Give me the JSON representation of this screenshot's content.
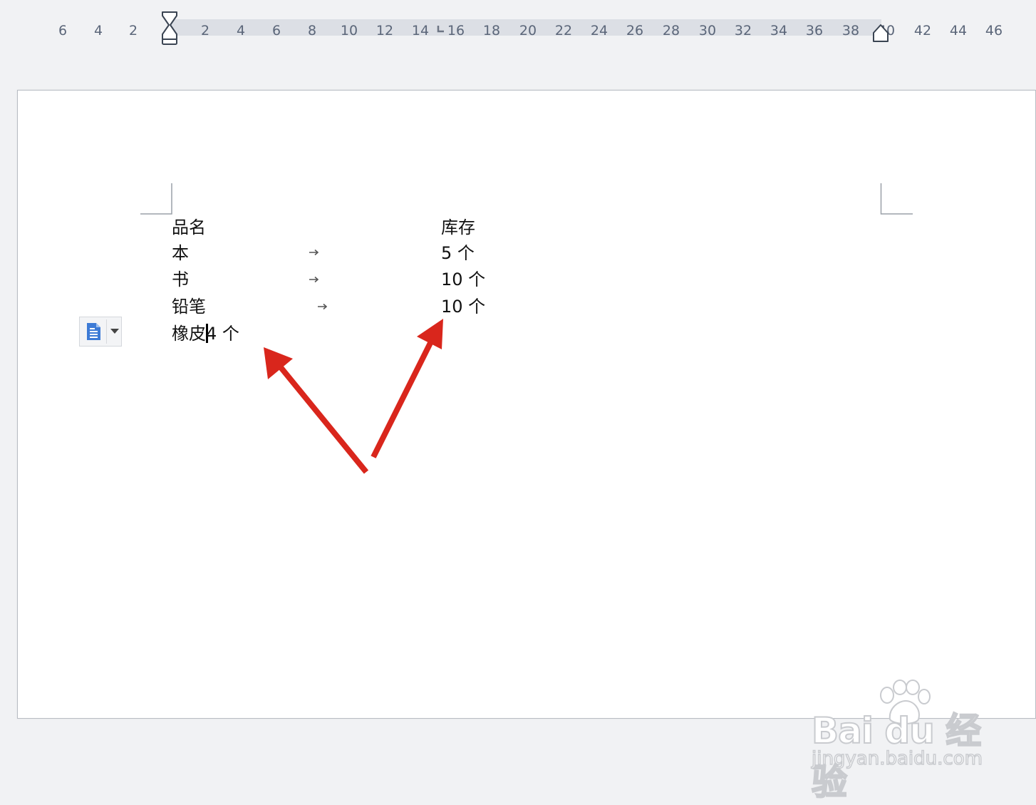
{
  "ruler": {
    "ticks": [
      "6",
      "4",
      "2",
      "2",
      "4",
      "6",
      "8",
      "10",
      "12",
      "14",
      "16",
      "18",
      "20",
      "22",
      "24",
      "26",
      "28",
      "30",
      "32",
      "34",
      "36",
      "38",
      "40",
      "42",
      "44",
      "46"
    ]
  },
  "document": {
    "header_row": {
      "name": "品名",
      "stock": "库存"
    },
    "rows": [
      {
        "name": "本",
        "stock": "5 个"
      },
      {
        "name": "书",
        "stock": "10 个"
      },
      {
        "name": "铅笔",
        "stock": "10 个"
      }
    ],
    "last_line": {
      "before_caret": "橡皮",
      "after_caret": "4 个"
    }
  },
  "watermark": {
    "brand": "Bai du 经验",
    "url": "jingyan.baidu.com"
  },
  "colors": {
    "arrow": "#d9261c",
    "ruler_band": "#dcdfe5",
    "ruler_text": "#5b6679",
    "paste_icon": "#3d7bd6"
  },
  "icons": {
    "paste_options": "paste-options-icon",
    "dropdown": "chevron-down-icon",
    "tab_marker": "tab-arrow-icon",
    "annotation_arrow": "red-arrow"
  }
}
